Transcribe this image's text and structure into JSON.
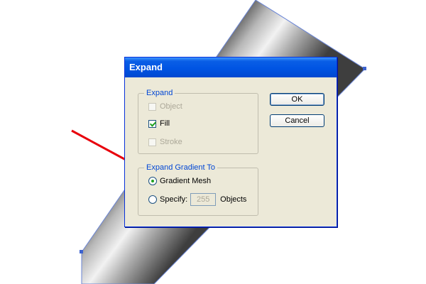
{
  "dialog": {
    "title": "Expand",
    "expand_group": {
      "title": "Expand",
      "object_label": "Object",
      "fill_label": "Fill",
      "stroke_label": "Stroke",
      "object_checked": false,
      "fill_checked": true,
      "stroke_checked": false
    },
    "gradient_group": {
      "title": "Expand Gradient To",
      "gradient_mesh_label": "Gradient Mesh",
      "specify_label": "Specify:",
      "specify_value": "255",
      "objects_label": "Objects",
      "selected": "gradient_mesh"
    },
    "ok_label": "OK",
    "cancel_label": "Cancel"
  },
  "colors": {
    "titlebar": "#0054e3",
    "dialog_bg": "#ece9d8",
    "arrow": "#e8000b",
    "group_title": "#0046d5"
  }
}
